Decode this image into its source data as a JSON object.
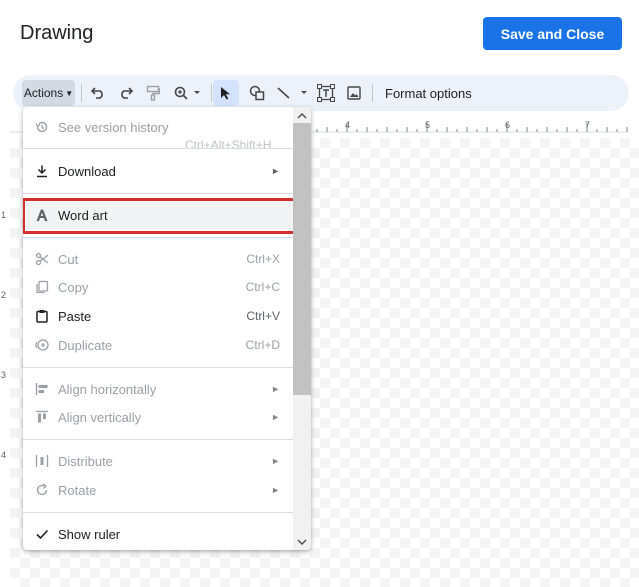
{
  "dialog": {
    "title": "Drawing",
    "save_label": "Save and Close"
  },
  "toolbar": {
    "actions_label": "Actions",
    "format_options_label": "Format options"
  },
  "ruler": {
    "top_numbers": [
      "4",
      "5",
      "6",
      "7"
    ],
    "left_numbers": [
      "1",
      "2",
      "3",
      "4"
    ]
  },
  "menu": {
    "items": [
      {
        "label": "See version history",
        "shortcut": "Ctrl+Alt+Shift+H",
        "icon": "history-icon",
        "enabled": false
      },
      {
        "label": "Download",
        "submenu": true,
        "icon": "download-icon",
        "enabled": true
      },
      {
        "label": "Word art",
        "icon": "word-art-icon",
        "enabled": true,
        "highlighted": true
      },
      {
        "label": "Cut",
        "shortcut": "Ctrl+X",
        "icon": "cut-icon",
        "enabled": false
      },
      {
        "label": "Copy",
        "shortcut": "Ctrl+C",
        "icon": "copy-icon",
        "enabled": false
      },
      {
        "label": "Paste",
        "shortcut": "Ctrl+V",
        "icon": "paste-icon",
        "enabled": true
      },
      {
        "label": "Duplicate",
        "shortcut": "Ctrl+D",
        "icon": "duplicate-icon",
        "enabled": false
      },
      {
        "label": "Align horizontally",
        "submenu": true,
        "icon": "align-horizontal-icon",
        "enabled": false
      },
      {
        "label": "Align vertically",
        "submenu": true,
        "icon": "align-vertical-icon",
        "enabled": false
      },
      {
        "label": "Distribute",
        "submenu": true,
        "icon": "distribute-icon",
        "enabled": false
      },
      {
        "label": "Rotate",
        "submenu": true,
        "icon": "rotate-icon",
        "enabled": false
      },
      {
        "label": "Show ruler",
        "icon": "check-icon",
        "enabled": true,
        "checked": true
      }
    ]
  },
  "colors": {
    "accent": "#1a73e8",
    "toolbar_bg": "#edf2fa",
    "highlight_border": "#d32f2f"
  }
}
